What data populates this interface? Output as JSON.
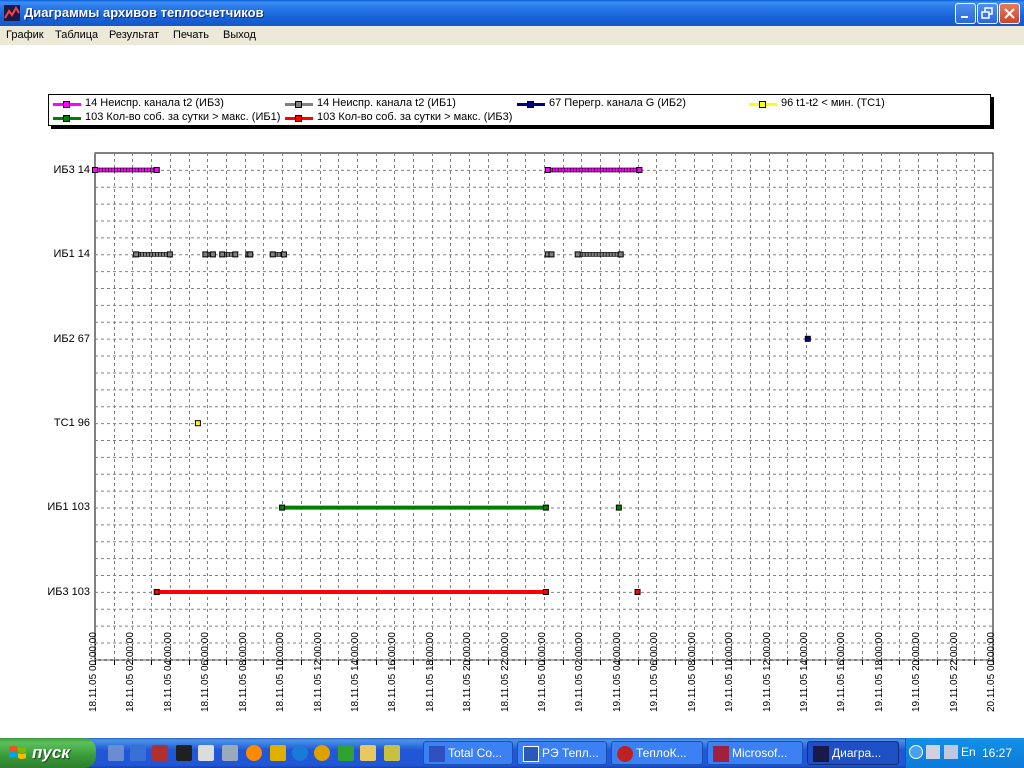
{
  "window": {
    "title": "Диаграммы архивов теплосчетчиков",
    "menu": [
      "График",
      "Таблица",
      "Результат",
      "Печать",
      "Выход"
    ]
  },
  "colors": {
    "magenta": "#ff00ff",
    "gray": "#808080",
    "navy": "#000080",
    "yellow": "#ffff00",
    "green": "#008000",
    "red": "#ff0000"
  },
  "chart_data": {
    "type": "timeline",
    "legend": [
      {
        "label": "14 Неиспр. канала t2 (ИБ3)",
        "color": "#ff00ff"
      },
      {
        "label": "14 Неиспр. канала t2 (ИБ1)",
        "color": "#808080"
      },
      {
        "label": "67 Перегр. канала G (ИБ2)",
        "color": "#000080"
      },
      {
        "label": "96 t1-t2 < мин. (ТС1)",
        "color": "#ffff00"
      },
      {
        "label": "103 Кол-во соб. за сутки > макс. (ИБ1)",
        "color": "#008000"
      },
      {
        "label": "103 Кол-во соб. за сутки > макс. (ИБ3)",
        "color": "#ff0000"
      }
    ],
    "rows": [
      "ИБ3 14",
      "ИБ1 14",
      "ИБ2 67",
      "ТС1 96",
      "ИБ1 103",
      "ИБ3 103"
    ],
    "x_ticks": [
      "18.11.05 00:00:00",
      "18.11.05 02:00:00",
      "18.11.05 04:00:00",
      "18.11.05 06:00:00",
      "18.11.05 08:00:00",
      "18.11.05 10:00:00",
      "18.11.05 12:00:00",
      "18.11.05 14:00:00",
      "18.11.05 16:00:00",
      "18.11.05 18:00:00",
      "18.11.05 20:00:00",
      "18.11.05 22:00:00",
      "19.11.05 00:00:00",
      "19.11.05 02:00:00",
      "19.11.05 04:00:00",
      "19.11.05 06:00:00",
      "19.11.05 08:00:00",
      "19.11.05 10:00:00",
      "19.11.05 12:00:00",
      "19.11.05 14:00:00",
      "19.11.05 16:00:00",
      "19.11.05 18:00:00",
      "19.11.05 20:00:00",
      "19.11.05 22:00:00",
      "20.11.05 00:00:00"
    ],
    "x_range_hours": [
      0,
      48
    ],
    "grid": true,
    "events": [
      {
        "row": "ИБ3 14",
        "color": "#ff00ff",
        "segments": [
          [
            0,
            3.3
          ],
          [
            24.2,
            29.1
          ]
        ]
      },
      {
        "row": "ИБ1 14",
        "color": "#808080",
        "segments": [
          [
            2.2,
            4.0
          ],
          [
            5.9,
            6.3
          ],
          [
            6.8,
            7.5
          ],
          [
            8.2,
            8.3
          ],
          [
            9.5,
            10.1
          ],
          [
            24.2,
            24.4
          ],
          [
            25.8,
            28.1
          ]
        ]
      },
      {
        "row": "ИБ2 67",
        "color": "#000080",
        "points": [
          38.1
        ]
      },
      {
        "row": "ТС1 96",
        "color": "#ffff00",
        "points": [
          5.5
        ]
      },
      {
        "row": "ИБ1 103",
        "color": "#008000",
        "segments": [
          [
            10.0,
            24.1
          ]
        ],
        "points": [
          28.0
        ]
      },
      {
        "row": "ИБ3 103",
        "color": "#ff0000",
        "segments": [
          [
            3.3,
            24.1
          ]
        ],
        "points": [
          29.0
        ]
      }
    ]
  },
  "taskbar": {
    "start_label": "пуск",
    "tasks": [
      "Total Co...",
      "РЭ Тепл...",
      "ТеплоК...",
      "Microsof...",
      "Диагра..."
    ],
    "lang": "En",
    "clock": "16:27"
  }
}
